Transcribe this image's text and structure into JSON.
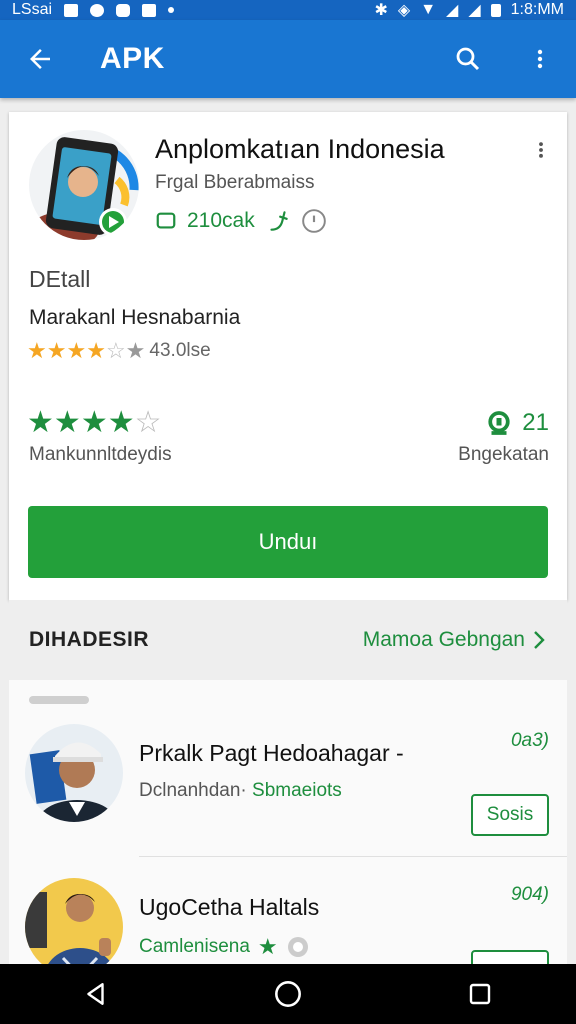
{
  "status_bar": {
    "left_text": "LSsai",
    "time": "1:8:MM"
  },
  "appbar": {
    "title": "APK",
    "back_icon": "arrow-left-icon",
    "search_icon": "search-icon",
    "menu_icon": "more-vert-icon"
  },
  "app": {
    "name": "Anplomkatıan Indonesia",
    "developer": "Frgal Bberabmaiss",
    "size": "210cak",
    "detail_heading": "DEtall",
    "detail_sub": "Marakanl Hesnabarnia",
    "rating_text": "43.0lse",
    "rating_stars": 3.5,
    "big_rating_stars": 4,
    "big_rating_label": "Mankunnltdeydis",
    "count": "21",
    "count_label": "Bngekatan",
    "install_label": "Unduı"
  },
  "section": {
    "title": "DIHADESIR",
    "more": "Mamoa Gebngan"
  },
  "list_items": [
    {
      "name": "Prkalk Pagt Hedoahagar -",
      "sub_prefix": "Dclnanhdan·",
      "sub_green": "Sbmaeiots",
      "price": "0a3)",
      "button": "Sosis"
    },
    {
      "name": "UgoCetha Haltals",
      "sub_green": "Camlenisena",
      "price": "904)"
    }
  ],
  "colors": {
    "primary": "#1976d2",
    "accent": "#23a03a",
    "text_green": "#1e8e3e",
    "star_orange": "#f5a623"
  }
}
